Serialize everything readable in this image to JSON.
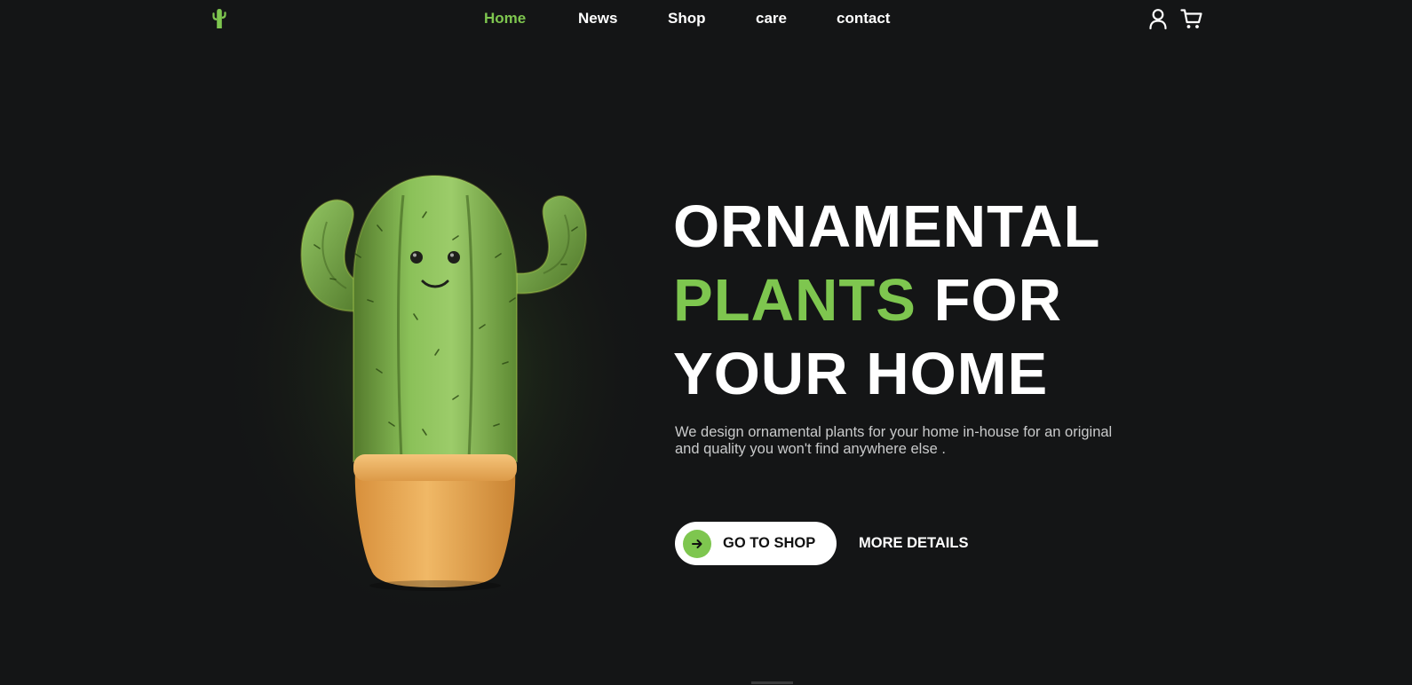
{
  "brand": {
    "logo_icon": "cactus-icon",
    "accent_color": "#7ec64f",
    "background_color": "#141516"
  },
  "nav": {
    "items": [
      {
        "label": "Home",
        "active": true
      },
      {
        "label": "News",
        "active": false
      },
      {
        "label": "Shop",
        "active": false
      },
      {
        "label": "care",
        "active": false
      },
      {
        "label": "contact",
        "active": false
      }
    ],
    "user_icon": "user-icon",
    "cart_icon": "cart-icon"
  },
  "hero": {
    "headline_line1": "ORNAMENTAL",
    "headline_accent": "PLANTS",
    "headline_line2_rest": " FOR",
    "headline_line3": "YOUR HOME",
    "description": "We design ornamental plants for your home in-house for an original and quality you won't find anywhere else .",
    "primary_button_label": "GO TO SHOP",
    "primary_button_icon": "arrow-right-icon",
    "secondary_button_label": "MORE DETAILS",
    "image": "cactus-in-pot-illustration"
  }
}
